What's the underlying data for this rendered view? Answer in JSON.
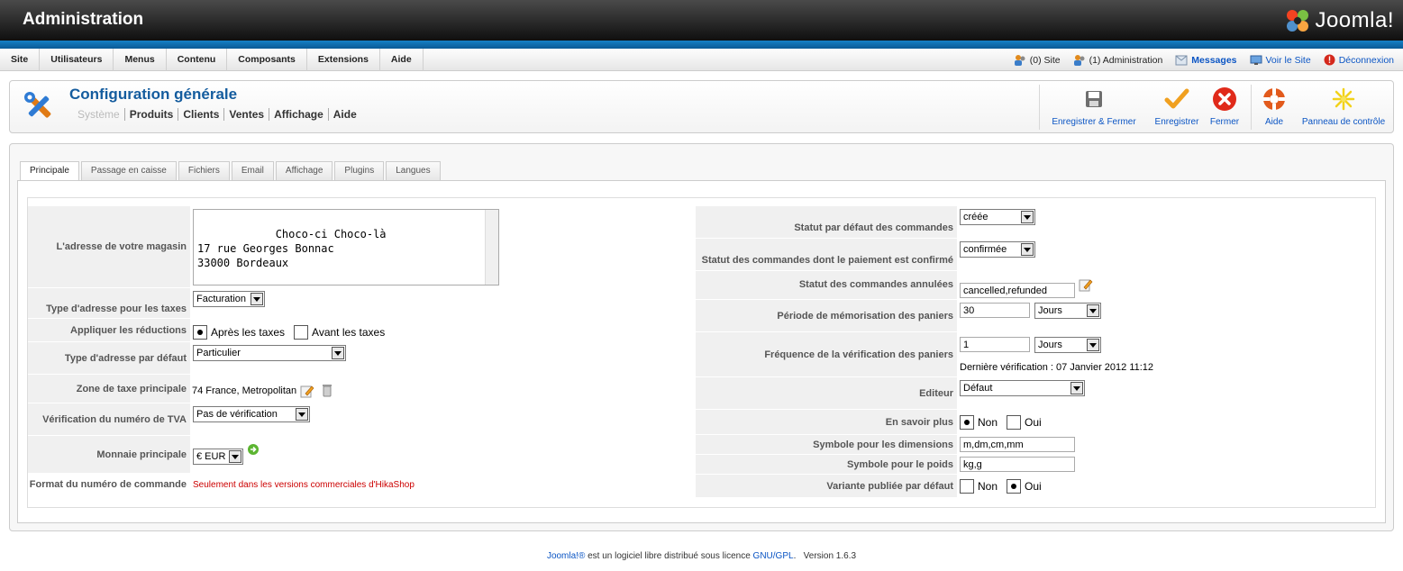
{
  "header": {
    "title": "Administration",
    "brand": "Joomla!"
  },
  "menubar": {
    "items": [
      "Site",
      "Utilisateurs",
      "Menus",
      "Contenu",
      "Composants",
      "Extensions",
      "Aide"
    ],
    "status": {
      "site": "(0) Site",
      "admin": "(1) Administration",
      "messages": "Messages",
      "view_site": "Voir le Site",
      "logout": "Déconnexion"
    }
  },
  "toolbar": {
    "page_title": "Configuration générale",
    "submenu": [
      "Système",
      "Produits",
      "Clients",
      "Ventes",
      "Affichage",
      "Aide"
    ],
    "buttons": {
      "save_close": "Enregistrer & Fermer",
      "save": "Enregistrer",
      "close": "Fermer",
      "help": "Aide",
      "control_panel": "Panneau de contrôle"
    }
  },
  "tabs": [
    "Principale",
    "Passage en caisse",
    "Fichiers",
    "Email",
    "Affichage",
    "Plugins",
    "Langues"
  ],
  "left": {
    "address_label": "L'adresse de votre magasin",
    "address_value": "Choco-ci Choco-là\n17 rue Georges Bonnac\n33000 Bordeaux",
    "tax_address_label": "Type d'adresse pour les taxes",
    "tax_address_value": "Facturation",
    "discount_label": "Appliquer les réductions",
    "discount_after": "Après les taxes",
    "discount_before": "Avant les taxes",
    "default_address_label": "Type d'adresse par défaut",
    "default_address_value": "Particulier",
    "tax_zone_label": "Zone de taxe principale",
    "tax_zone_value": "74 France, Metropolitan",
    "vat_label": "Vérification du numéro de TVA",
    "vat_value": "Pas de vérification",
    "currency_label": "Monnaie principale",
    "currency_value": "€ EUR",
    "order_format_label": "Format du numéro de commande",
    "order_format_value": "Seulement dans les versions commerciales d'HikaShop"
  },
  "right": {
    "default_status_label": "Statut par défaut des commandes",
    "default_status_value": "créée",
    "paid_status_label": "Statut des commandes dont le paiement est confirmé",
    "paid_status_value": "confirmée",
    "cancelled_status_label": "Statut des commandes annulées",
    "cancelled_status_value": "cancelled,refunded",
    "cart_period_label": "Période de mémorisation des paniers",
    "cart_period_value": "30",
    "cart_period_unit": "Jours",
    "cart_check_label": "Fréquence de la vérification des paniers",
    "cart_check_value": "1",
    "cart_check_unit": "Jours",
    "last_check": "Dernière vérification : 07 Janvier 2012 11:12",
    "editor_label": "Editeur",
    "editor_value": "Défaut",
    "learn_more_label": "En savoir plus",
    "learn_more_no": "Non",
    "learn_more_yes": "Oui",
    "dimension_label": "Symbole pour les dimensions",
    "dimension_value": "m,dm,cm,mm",
    "weight_label": "Symbole pour le poids",
    "weight_value": "kg,g",
    "variant_label": "Variante publiée par défaut",
    "variant_no": "Non",
    "variant_yes": "Oui"
  },
  "footer": {
    "joomla": "Joomla!®",
    "text": " est un logiciel libre distribué sous licence ",
    "license": "GNU/GPL",
    "version": ".   Version 1.6.3"
  },
  "colors": {
    "accent_blue": "#145c9e",
    "link": "#0b55c4",
    "header_bar": "#1580c6"
  }
}
